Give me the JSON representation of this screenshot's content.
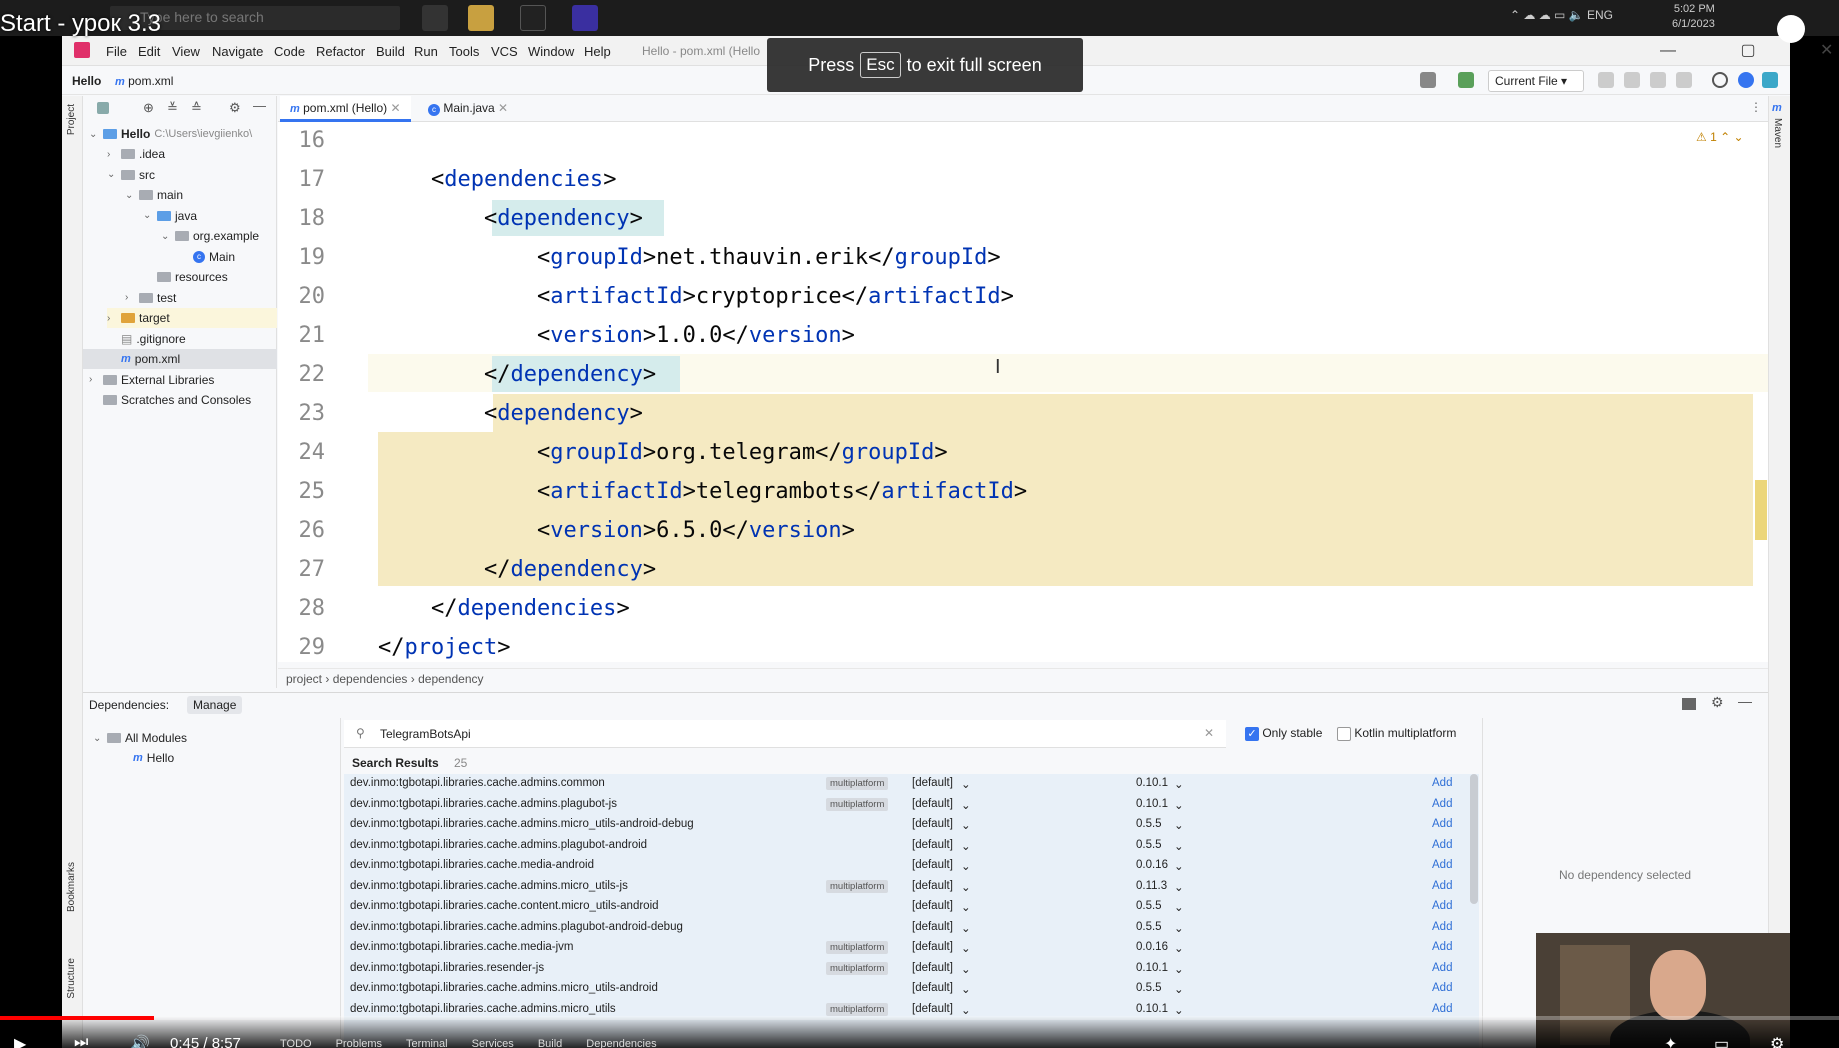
{
  "video": {
    "title": "Start - урок 3.3",
    "time_current": "0:45",
    "time_total": "8:57",
    "time_display": "0:45 / 8:57",
    "progress": 0.084
  },
  "os": {
    "search_placeholder": "Type here to search",
    "tray_lang": "ENG",
    "time": "5:02 PM",
    "date": "6/1/2023"
  },
  "fullscreen_notice": {
    "prefix": "Press",
    "key": "Esc",
    "suffix": "to exit full screen"
  },
  "menu": [
    "File",
    "Edit",
    "View",
    "Navigate",
    "Code",
    "Refactor",
    "Build",
    "Run",
    "Tools",
    "VCS",
    "Window",
    "Help"
  ],
  "window_title": "Hello - pom.xml (Hello",
  "nav": {
    "project": "Hello",
    "file": "pom.xml",
    "run_config": "Current File"
  },
  "project_tree": {
    "root_name": "Hello",
    "root_path": "C:\\Users\\ievgiienko\\",
    "items": [
      {
        "label": ".idea",
        "depth": 1
      },
      {
        "label": "src",
        "depth": 1
      },
      {
        "label": "main",
        "depth": 2
      },
      {
        "label": "java",
        "depth": 3
      },
      {
        "label": "org.example",
        "depth": 4
      },
      {
        "label": "Main",
        "depth": 5
      },
      {
        "label": "resources",
        "depth": 3
      },
      {
        "label": "test",
        "depth": 2
      },
      {
        "label": "target",
        "depth": 1
      },
      {
        "label": ".gitignore",
        "depth": 1
      },
      {
        "label": "pom.xml",
        "depth": 1
      },
      {
        "label": "External Libraries",
        "depth": 0
      },
      {
        "label": "Scratches and Consoles",
        "depth": 0
      }
    ]
  },
  "tabs": [
    {
      "label": "pom.xml (Hello)",
      "active": true
    },
    {
      "label": "Main.java",
      "active": false
    }
  ],
  "editor": {
    "warning_count": "1",
    "lines": [
      {
        "n": "16",
        "text": ""
      },
      {
        "n": "17",
        "text": "    <dependencies>"
      },
      {
        "n": "18",
        "text": "        <dependency>"
      },
      {
        "n": "19",
        "text": "            <groupId>net.thauvin.erik</groupId>"
      },
      {
        "n": "20",
        "text": "            <artifactId>cryptoprice</artifactId>"
      },
      {
        "n": "21",
        "text": "            <version>1.0.0</version>"
      },
      {
        "n": "22",
        "text": "        </dependency>"
      },
      {
        "n": "23",
        "text": "        <dependency>"
      },
      {
        "n": "24",
        "text": "            <groupId>org.telegram</groupId>"
      },
      {
        "n": "25",
        "text": "            <artifactId>telegrambots</artifactId>"
      },
      {
        "n": "26",
        "text": "            <version>6.5.0</version>"
      },
      {
        "n": "27",
        "text": "        </dependency>"
      },
      {
        "n": "28",
        "text": "    </dependencies>"
      },
      {
        "n": "29",
        "text": "</project>"
      }
    ],
    "breadcrumb": [
      "project",
      "dependencies",
      "dependency"
    ]
  },
  "dependencies_panel": {
    "title": "Dependencies:",
    "tab": "Manage",
    "modules": [
      "All Modules",
      "Hello"
    ],
    "search_value": "TelegramBotsApi",
    "only_stable_label": "Only stable",
    "only_stable_checked": true,
    "kotlin_mp_label": "Kotlin multiplatform",
    "results_label": "Search Results",
    "results_count": "25",
    "no_selection": "No dependency selected",
    "add_label": "Add",
    "scope": "[default]",
    "results": [
      {
        "name": "dev.inmo:tgbotapi.libraries.cache.admins.common",
        "mp": true,
        "version": "0.10.1"
      },
      {
        "name": "dev.inmo:tgbotapi.libraries.cache.admins.plagubot-js",
        "mp": true,
        "version": "0.10.1"
      },
      {
        "name": "dev.inmo:tgbotapi.libraries.cache.admins.micro_utils-android-debug",
        "mp": false,
        "version": "0.5.5"
      },
      {
        "name": "dev.inmo:tgbotapi.libraries.cache.admins.plagubot-android",
        "mp": false,
        "version": "0.5.5"
      },
      {
        "name": "dev.inmo:tgbotapi.libraries.cache.media-android",
        "mp": false,
        "version": "0.0.16"
      },
      {
        "name": "dev.inmo:tgbotapi.libraries.cache.admins.micro_utils-js",
        "mp": true,
        "version": "0.11.3"
      },
      {
        "name": "dev.inmo:tgbotapi.libraries.cache.content.micro_utils-android",
        "mp": false,
        "version": "0.5.5"
      },
      {
        "name": "dev.inmo:tgbotapi.libraries.cache.admins.plagubot-android-debug",
        "mp": false,
        "version": "0.5.5"
      },
      {
        "name": "dev.inmo:tgbotapi.libraries.cache.media-jvm",
        "mp": true,
        "version": "0.0.16"
      },
      {
        "name": "dev.inmo:tgbotapi.libraries.resender-js",
        "mp": true,
        "version": "0.10.1"
      },
      {
        "name": "dev.inmo:tgbotapi.libraries.cache.admins.micro_utils-android",
        "mp": false,
        "version": "0.5.5"
      },
      {
        "name": "dev.inmo:tgbotapi.libraries.cache.admins.micro_utils",
        "mp": true,
        "version": "0.10.1"
      }
    ],
    "mp_label": "multiplatform"
  },
  "side_labels": {
    "project": "Project",
    "bookmarks": "Bookmarks",
    "structure": "Structure",
    "maven": "Maven"
  },
  "bottom_tabs": [
    "TODO",
    "Problems",
    "Terminal",
    "Services",
    "Build",
    "Dependencies"
  ],
  "colors": {
    "accent": "#3574f0",
    "tag": "#0033b3",
    "highlight": "#f5eac2",
    "progress": "#ff0000"
  }
}
